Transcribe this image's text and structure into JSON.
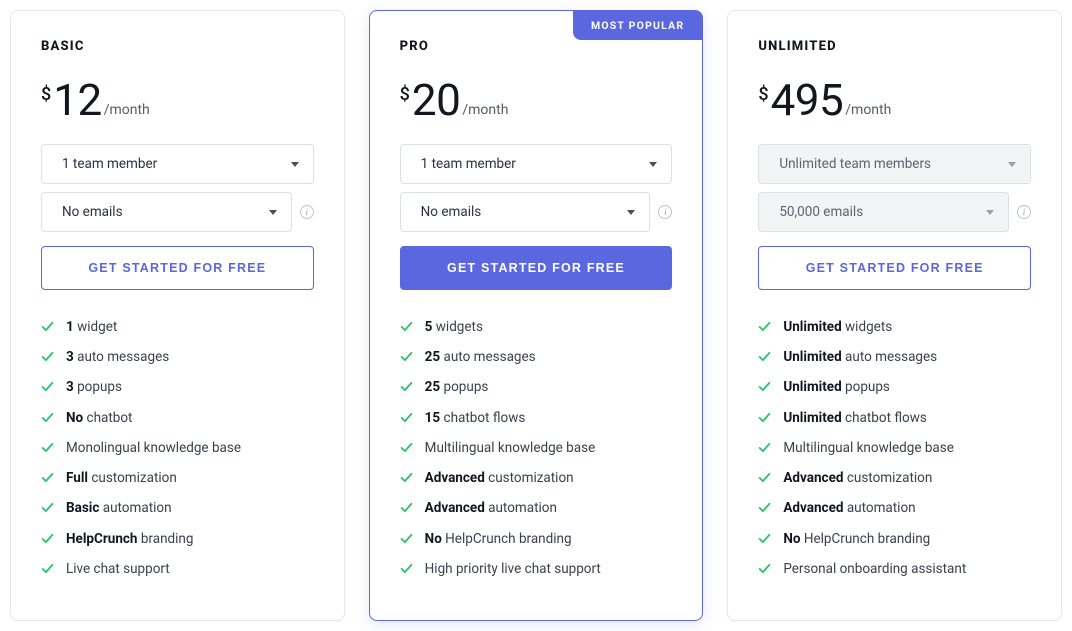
{
  "common": {
    "currency": "$",
    "period": "/month",
    "cta_label": "GET STARTED FOR FREE"
  },
  "plans": [
    {
      "name": "BASIC",
      "price": "12",
      "badge": null,
      "featured": false,
      "cta_style": "outline",
      "selects": [
        {
          "value": "1 team member",
          "disabled": false,
          "info": false
        },
        {
          "value": "No emails",
          "disabled": false,
          "info": true
        }
      ],
      "features": [
        {
          "bold": "1",
          "rest": " widget"
        },
        {
          "bold": "3",
          "rest": " auto messages"
        },
        {
          "bold": "3",
          "rest": " popups"
        },
        {
          "bold": "No",
          "rest": " chatbot"
        },
        {
          "bold": null,
          "rest": "Monolingual knowledge base"
        },
        {
          "bold": "Full",
          "rest": " customization"
        },
        {
          "bold": "Basic",
          "rest": " automation"
        },
        {
          "bold": "HelpCrunch",
          "rest": " branding"
        },
        {
          "bold": null,
          "rest": "Live chat support"
        }
      ]
    },
    {
      "name": "PRO",
      "price": "20",
      "badge": "MOST POPULAR",
      "featured": true,
      "cta_style": "solid",
      "selects": [
        {
          "value": "1 team member",
          "disabled": false,
          "info": false
        },
        {
          "value": "No emails",
          "disabled": false,
          "info": true
        }
      ],
      "features": [
        {
          "bold": "5",
          "rest": " widgets"
        },
        {
          "bold": "25",
          "rest": " auto messages"
        },
        {
          "bold": "25",
          "rest": " popups"
        },
        {
          "bold": "15",
          "rest": " chatbot flows"
        },
        {
          "bold": null,
          "rest": "Multilingual knowledge base"
        },
        {
          "bold": "Advanced",
          "rest": " customization"
        },
        {
          "bold": "Advanced",
          "rest": " automation"
        },
        {
          "bold": "No",
          "rest": " HelpCrunch branding"
        },
        {
          "bold": null,
          "rest": "High priority live chat support"
        }
      ]
    },
    {
      "name": "UNLIMITED",
      "price": "495",
      "badge": null,
      "featured": false,
      "cta_style": "outline",
      "selects": [
        {
          "value": "Unlimited team members",
          "disabled": true,
          "info": false
        },
        {
          "value": "50,000 emails",
          "disabled": true,
          "info": true
        }
      ],
      "features": [
        {
          "bold": "Unlimited",
          "rest": " widgets"
        },
        {
          "bold": "Unlimited",
          "rest": " auto messages"
        },
        {
          "bold": "Unlimited",
          "rest": " popups"
        },
        {
          "bold": "Unlimited",
          "rest": " chatbot flows"
        },
        {
          "bold": null,
          "rest": "Multilingual knowledge base"
        },
        {
          "bold": "Advanced",
          "rest": " customization"
        },
        {
          "bold": "Advanced",
          "rest": " automation"
        },
        {
          "bold": "No",
          "rest": " HelpCrunch branding"
        },
        {
          "bold": null,
          "rest": "Personal onboarding assistant"
        }
      ]
    }
  ]
}
